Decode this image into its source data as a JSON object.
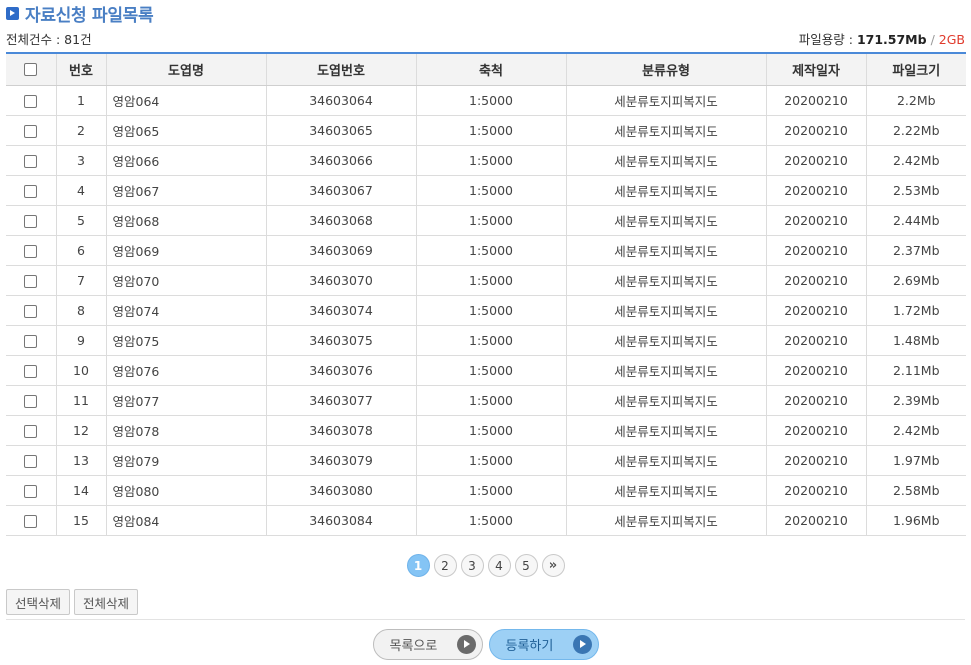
{
  "page": {
    "title": "자료신청 파일목록",
    "total_label": "전체건수 : 81건",
    "size_label": "파일용량 : ",
    "size_used": "171.57Mb",
    "size_sep": "/",
    "size_limit": "2GB"
  },
  "colors": {
    "accent": "#4a89d8",
    "limit": "#e03b2d",
    "active_page": "#84c4f5"
  },
  "table": {
    "headers": [
      "번호",
      "도엽명",
      "도엽번호",
      "축척",
      "분류유형",
      "제작일자",
      "파일크기"
    ],
    "rows": [
      {
        "no": "1",
        "name": "영암064",
        "code": "34603064",
        "scale": "1:5000",
        "type": "세분류토지피복지도",
        "date": "20200210",
        "size": "2.2Mb"
      },
      {
        "no": "2",
        "name": "영암065",
        "code": "34603065",
        "scale": "1:5000",
        "type": "세분류토지피복지도",
        "date": "20200210",
        "size": "2.22Mb"
      },
      {
        "no": "3",
        "name": "영암066",
        "code": "34603066",
        "scale": "1:5000",
        "type": "세분류토지피복지도",
        "date": "20200210",
        "size": "2.42Mb"
      },
      {
        "no": "4",
        "name": "영암067",
        "code": "34603067",
        "scale": "1:5000",
        "type": "세분류토지피복지도",
        "date": "20200210",
        "size": "2.53Mb"
      },
      {
        "no": "5",
        "name": "영암068",
        "code": "34603068",
        "scale": "1:5000",
        "type": "세분류토지피복지도",
        "date": "20200210",
        "size": "2.44Mb"
      },
      {
        "no": "6",
        "name": "영암069",
        "code": "34603069",
        "scale": "1:5000",
        "type": "세분류토지피복지도",
        "date": "20200210",
        "size": "2.37Mb"
      },
      {
        "no": "7",
        "name": "영암070",
        "code": "34603070",
        "scale": "1:5000",
        "type": "세분류토지피복지도",
        "date": "20200210",
        "size": "2.69Mb"
      },
      {
        "no": "8",
        "name": "영암074",
        "code": "34603074",
        "scale": "1:5000",
        "type": "세분류토지피복지도",
        "date": "20200210",
        "size": "1.72Mb"
      },
      {
        "no": "9",
        "name": "영암075",
        "code": "34603075",
        "scale": "1:5000",
        "type": "세분류토지피복지도",
        "date": "20200210",
        "size": "1.48Mb"
      },
      {
        "no": "10",
        "name": "영암076",
        "code": "34603076",
        "scale": "1:5000",
        "type": "세분류토지피복지도",
        "date": "20200210",
        "size": "2.11Mb"
      },
      {
        "no": "11",
        "name": "영암077",
        "code": "34603077",
        "scale": "1:5000",
        "type": "세분류토지피복지도",
        "date": "20200210",
        "size": "2.39Mb"
      },
      {
        "no": "12",
        "name": "영암078",
        "code": "34603078",
        "scale": "1:5000",
        "type": "세분류토지피복지도",
        "date": "20200210",
        "size": "2.42Mb"
      },
      {
        "no": "13",
        "name": "영암079",
        "code": "34603079",
        "scale": "1:5000",
        "type": "세분류토지피복지도",
        "date": "20200210",
        "size": "1.97Mb"
      },
      {
        "no": "14",
        "name": "영암080",
        "code": "34603080",
        "scale": "1:5000",
        "type": "세분류토지피복지도",
        "date": "20200210",
        "size": "2.58Mb"
      },
      {
        "no": "15",
        "name": "영암084",
        "code": "34603084",
        "scale": "1:5000",
        "type": "세분류토지피복지도",
        "date": "20200210",
        "size": "1.96Mb"
      }
    ]
  },
  "pagination": {
    "pages": [
      "1",
      "2",
      "3",
      "4",
      "5"
    ],
    "current": "1",
    "next_label": "»"
  },
  "buttons": {
    "delete_selected": "선택삭제",
    "delete_all": "전체삭제",
    "back_to_list": "목록으로",
    "register": "등록하기"
  }
}
